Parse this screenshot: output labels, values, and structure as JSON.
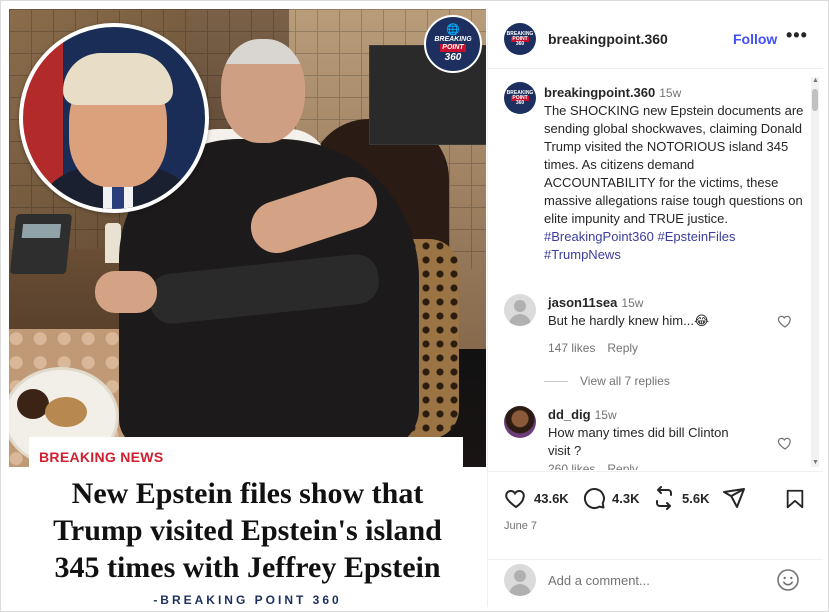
{
  "media": {
    "logo": {
      "line1": "BREAKING",
      "line2": "POINT",
      "line3": "360"
    },
    "breaking_label": "BREAKING NEWS",
    "headline": [
      "New Epstein files show that",
      "Trump visited Epstein's island",
      "345 times with Jeffrey Epstein"
    ],
    "byline": "-BREAKING POINT 360"
  },
  "header": {
    "username": "breakingpoint.360",
    "follow_label": "Follow",
    "more_label": "•••"
  },
  "caption": {
    "username": "breakingpoint.360",
    "time": "15w",
    "text": "The SHOCKING new Epstein documents are sending global shockwaves, claiming Donald Trump visited the NOTORIOUS island 345 times. As citizens demand ACCOUNTABILITY for the victims, these massive allegations raise tough questions on elite impunity and TRUE justice.",
    "hashtags": "#BreakingPoint360 #EpsteinFiles #TrumpNews"
  },
  "comments": [
    {
      "username": "jason11sea",
      "time": "15w",
      "text": "But he hardly knew him...😂",
      "likes": "147 likes",
      "reply": "Reply",
      "view_replies": "View all 7 replies"
    },
    {
      "username": "dd_dig",
      "time": "15w",
      "text": "How many times did bill Clinton visit ?",
      "likes": "260 likes",
      "reply": "Reply"
    }
  ],
  "actions": {
    "likes": "43.6K",
    "comments": "4.3K",
    "reposts": "5.6K",
    "date": "June 7"
  },
  "add_comment": {
    "placeholder": "Add a comment..."
  },
  "colors": {
    "follow": "#4150f7",
    "hashtag": "#3b3d9e",
    "brand_navy": "#1c2f5e",
    "breaking_red": "#d01f2f"
  }
}
